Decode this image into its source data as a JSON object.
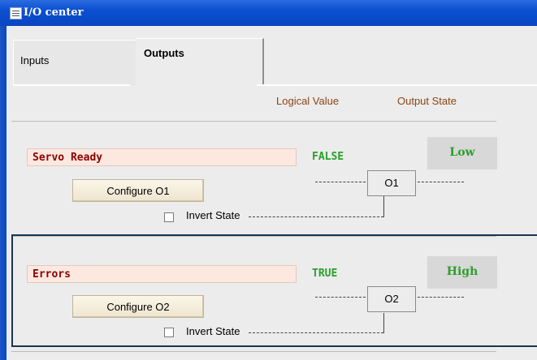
{
  "window": {
    "title": "I/O center"
  },
  "tabs": {
    "inputs": "Inputs",
    "outputs": "Outputs"
  },
  "columns": {
    "logical_value": "Logical Value",
    "output_state": "Output State"
  },
  "outputs": [
    {
      "name": "Servo Ready",
      "logical_value": "FALSE",
      "state": "Low",
      "button": "Configure O1",
      "output_id": "O1",
      "invert_label": "Invert State",
      "invert_checked": false
    },
    {
      "name": "Errors",
      "logical_value": "TRUE",
      "state": "High",
      "button": "Configure O2",
      "output_id": "O2",
      "invert_label": "Invert State",
      "invert_checked": false
    }
  ],
  "colors": {
    "title_bar": "#0b4fd0",
    "logical_value": "#2aa02a",
    "name_text": "#8b0000",
    "name_bg": "#fde8e0",
    "highlight_border": "#1c3550"
  }
}
